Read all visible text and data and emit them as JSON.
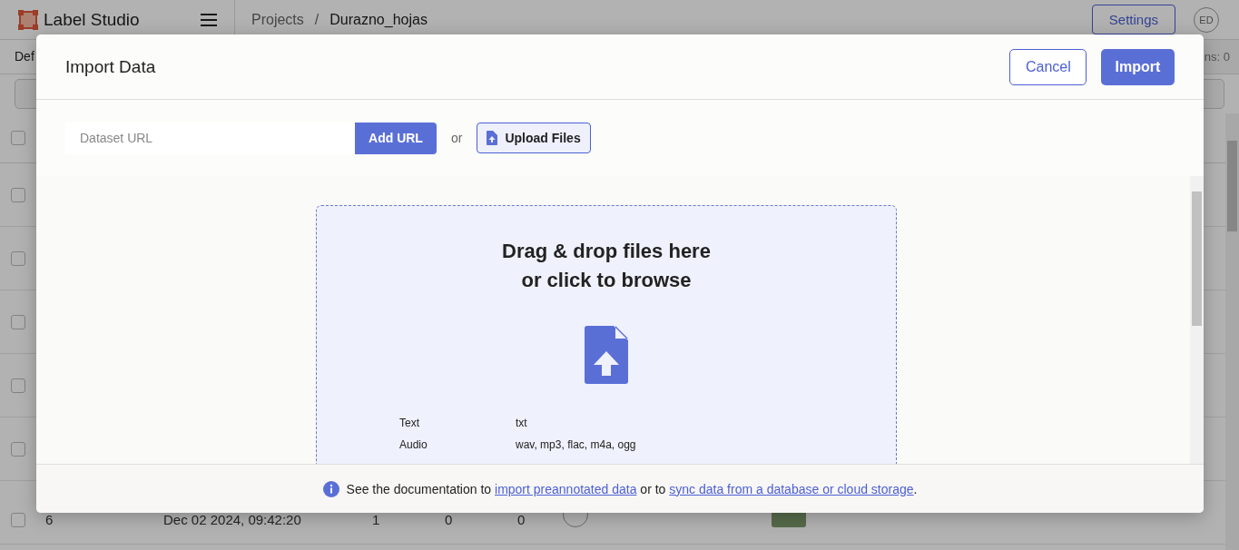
{
  "app": {
    "logo_text": "Label Studio",
    "breadcrumb": [
      {
        "label": "Projects"
      },
      {
        "label": "Durazno_hojas"
      }
    ],
    "separator": "/",
    "settings_button": "Settings",
    "avatar": "ED"
  },
  "background": {
    "tab": "Def",
    "counter": "ns: 0",
    "header_checkbox": {
      "checked": false
    },
    "rows": [
      {
        "checked": false
      },
      {
        "checked": false
      },
      {
        "checked": false
      },
      {
        "checked": false
      },
      {
        "checked": false
      }
    ],
    "last_row": {
      "checked": false,
      "cells": [
        "6",
        "Dec 02 2024, 09:42:20",
        "1",
        "0",
        "0"
      ]
    }
  },
  "dialog": {
    "title": "Import Data",
    "cancel_button": "Cancel",
    "import_button": "Import",
    "url_placeholder": "Dataset URL",
    "add_url_button": "Add URL",
    "or": "or",
    "upload_button": "Upload Files",
    "drop_title": "Drag & drop files here",
    "drop_subtitle": "or click to browse",
    "formats": [
      {
        "type": "Text",
        "extensions": "txt"
      },
      {
        "type": "Audio",
        "extensions": "wav, mp3, flac, m4a, ogg"
      }
    ],
    "footer": [
      {
        "kind": "text",
        "text": "See the documentation to "
      },
      {
        "kind": "link",
        "text": "import preannotated data"
      },
      {
        "kind": "text",
        "text": " or to "
      },
      {
        "kind": "link",
        "text": "sync data from a database or cloud storage"
      },
      {
        "kind": "text",
        "text": "."
      }
    ]
  }
}
